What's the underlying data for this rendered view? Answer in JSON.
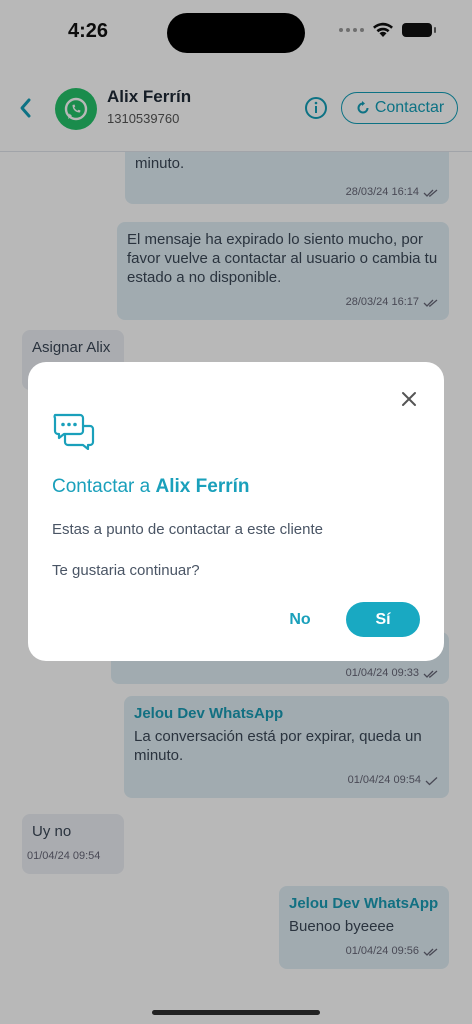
{
  "status": {
    "time": "4:26"
  },
  "header": {
    "name": "Alix Ferrín",
    "phone": "1310539760",
    "contact_label": "Contactar"
  },
  "messages": {
    "m1": {
      "text": "minuto.",
      "time": "28/03/24 16:14"
    },
    "m2": {
      "text": "El mensaje ha expirado lo siento mucho, por favor vuelve a contactar al usuario o cambia tu estado a no disponible.",
      "time": "28/03/24 16:17"
    },
    "m3": {
      "text": "Asignar Alix"
    },
    "m4": {
      "time": "01/04/24 09:33"
    },
    "m5": {
      "sender": "Jelou Dev WhatsApp",
      "text": "La conversación está por expirar, queda un minuto.",
      "time": "01/04/24 09:54"
    },
    "m6": {
      "text": "Uy no",
      "time": "01/04/24 09:54"
    },
    "m7": {
      "sender": "Jelou Dev WhatsApp",
      "text": "Buenoo byeeee",
      "time": "01/04/24 09:56"
    }
  },
  "modal": {
    "title_prefix": "Contactar a",
    "title_name": "Alix Ferrín",
    "line1": "Estas a punto de contactar a este cliente",
    "line2": "Te gustaria continuar?",
    "no_label": "No",
    "yes_label": "Sí"
  },
  "colors": {
    "accent": "#19a9c2",
    "whatsapp": "#25c36a"
  }
}
